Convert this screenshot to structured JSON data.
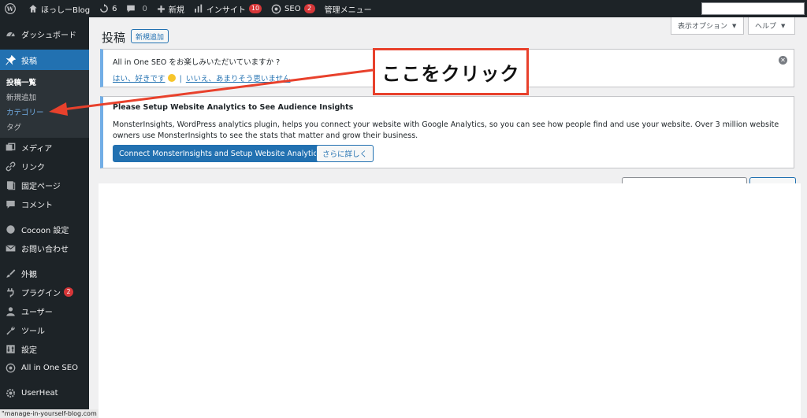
{
  "adminbar": {
    "site_name": "ほっしーBlog",
    "updates_count": "6",
    "comments_count": "0",
    "new_label": "新規",
    "insights_label": "インサイト",
    "insights_badge": "10",
    "seo_label": "SEO",
    "seo_badge": "2",
    "manage_menu": "管理メニュー"
  },
  "sidebar": {
    "dashboard": "ダッシュボード",
    "posts": "投稿",
    "submenu": {
      "all_posts": "投稿一覧",
      "add_new": "新規追加",
      "categories": "カテゴリー",
      "tags": "タグ"
    },
    "media": "メディア",
    "links": "リンク",
    "pages": "固定ページ",
    "comments": "コメント",
    "cocoon": "Cocoon 設定",
    "contact": "お問い合わせ",
    "appearance": "外観",
    "plugins": "プラグイン",
    "plugins_badge": "2",
    "users": "ユーザー",
    "tools": "ツール",
    "settings": "設定",
    "aioseo": "All in One SEO",
    "userheat": "UserHeat"
  },
  "statusbar": {
    "url": "\"manage-in-yourself-blog.com"
  },
  "top_buttons": {
    "screen_options": "表示オプション",
    "help": "ヘルプ"
  },
  "page": {
    "title": "投稿",
    "add_new": "新規追加"
  },
  "notice_seo": {
    "question": "All in One SEO をお楽しみいただいていますか ?",
    "yes_link": "はい、好きです",
    "separator": "|",
    "no_link": "いいえ、あまりそう思いません"
  },
  "notice_mi": {
    "title": "Please Setup Website Analytics to See Audience Insights",
    "description": "MonsterInsights, WordPress analytics plugin, helps you connect your website with Google Analytics, so you can see how people find and use your website. Over 3 million website owners use MonsterInsights to see the stats that matter and grow their business.",
    "connect_button": "Connect MonsterInsights and Setup Website Analytics",
    "more_button": "さらに詳しく"
  },
  "annotation": {
    "text": "ここをクリック",
    "color": "#e8412c"
  }
}
